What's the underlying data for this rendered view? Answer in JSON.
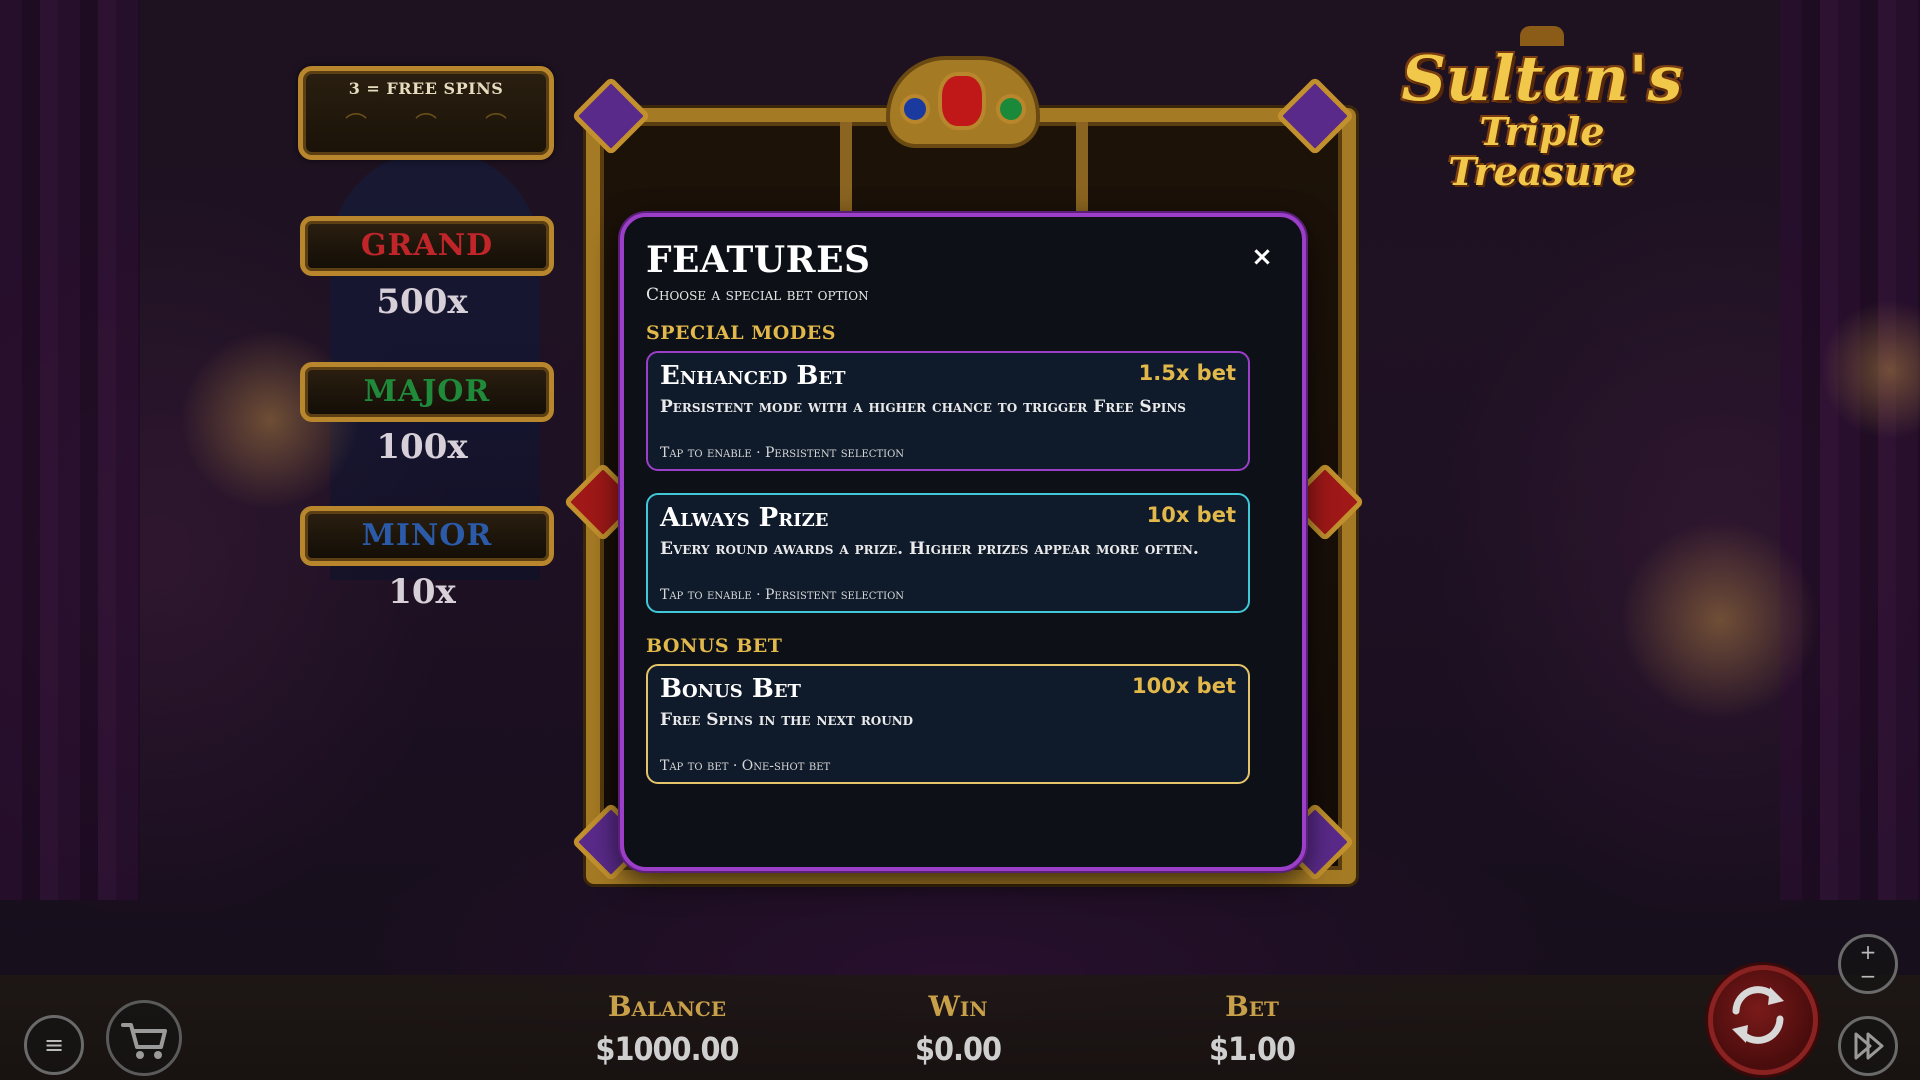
{
  "game": {
    "logo_line1": "Sultan's",
    "logo_line2": "Triple Treasure"
  },
  "free_spins_panel": {
    "label": "3 = FREE SPINS"
  },
  "jackpots": [
    {
      "name": "GRAND",
      "value": "500x",
      "color": "#c0252a"
    },
    {
      "name": "MAJOR",
      "value": "100x",
      "color": "#1f8a3a"
    },
    {
      "name": "MINOR",
      "value": "10x",
      "color": "#2a5aa8"
    }
  ],
  "modal": {
    "title": "FEATURES",
    "subtitle": "Choose a special bet option",
    "close_glyph": "×",
    "special_modes_heading": "SPECIAL MODES",
    "bonus_bet_heading": "BONUS BET",
    "cards": [
      {
        "title": "Enhanced Bet",
        "multiplier": "1.5x bet",
        "description": "Persistent mode with a higher chance to trigger Free Spins",
        "footer": "Tap to enable · Persistent selection",
        "border_color": "#9b3fc8"
      },
      {
        "title": "Always Prize",
        "multiplier": "10x bet",
        "description": "Every round awards a prize. Higher prizes appear more often.",
        "footer": "Tap to enable · Persistent selection",
        "border_color": "#3fc8d8"
      },
      {
        "title": "Bonus Bet",
        "multiplier": "100x bet",
        "description": "Free Spins in the next round",
        "footer": "Tap to bet · One-shot bet",
        "border_color": "#e3c46a"
      }
    ]
  },
  "hud": {
    "balance_label": "Balance",
    "balance_value": "$1000.00",
    "win_label": "Win",
    "win_value": "$0.00",
    "bet_label": "Bet",
    "bet_value": "$1.00"
  },
  "controls": {
    "menu_icon": "hamburger-menu-icon",
    "cart_icon": "shopping-cart-icon",
    "spin_icon": "refresh-arrows-icon",
    "zoom_icon": "plus-minus-icon",
    "fast_forward_icon": "fast-forward-icon",
    "zoom_plus": "+",
    "zoom_minus": "−"
  }
}
